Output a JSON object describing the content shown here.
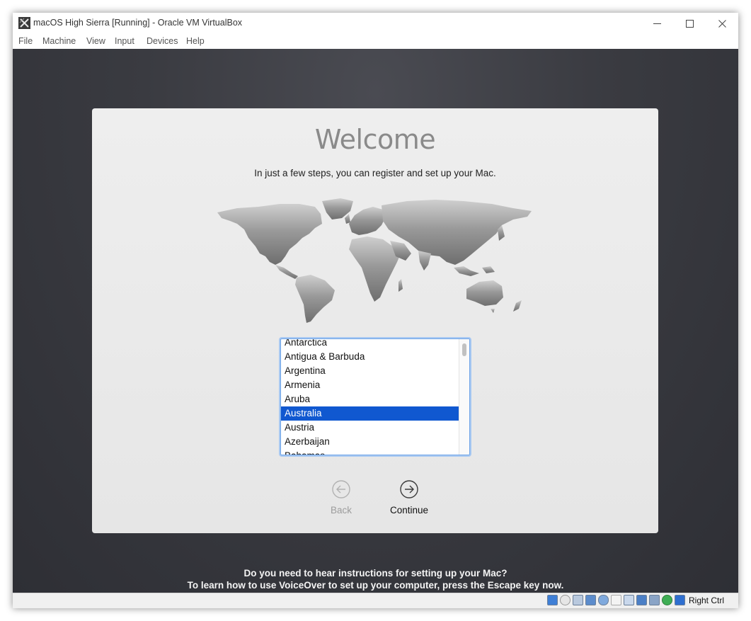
{
  "window": {
    "title": "macOS High Sierra [Running] - Oracle VM VirtualBox",
    "controls": [
      "minimize",
      "maximize",
      "close"
    ]
  },
  "menu": {
    "items": [
      "File",
      "Machine",
      "View",
      "Input",
      "Devices",
      "Help"
    ]
  },
  "setup": {
    "heading": "Welcome",
    "subtitle": "In just a few steps, you can register and set up your Mac.",
    "countries": [
      "Antarctica",
      "Antigua & Barbuda",
      "Argentina",
      "Armenia",
      "Aruba",
      "Australia",
      "Austria",
      "Azerbaijan",
      "Bahamas"
    ],
    "selected_country": "Australia",
    "back_label": "Back",
    "continue_label": "Continue"
  },
  "voiceover": {
    "line1": "Do you need to hear instructions for setting up your Mac?",
    "line2": "To learn how to use VoiceOver to set up your computer, press the Escape key now."
  },
  "statusbar": {
    "icons": [
      "hard-disk-icon",
      "optical-drive-icon",
      "audio-icon",
      "network-icon",
      "usb-icon",
      "shared-folders-icon",
      "display-icon",
      "video-capture-icon",
      "recording-icon",
      "cpu-icon",
      "mouse-integration-icon"
    ],
    "host_key": "Right Ctrl"
  },
  "colors": {
    "vm_background": "#3a3b41",
    "panel": "#eeeeee",
    "selection": "#1058d0",
    "listbox_focus": "#6fa5e8"
  }
}
